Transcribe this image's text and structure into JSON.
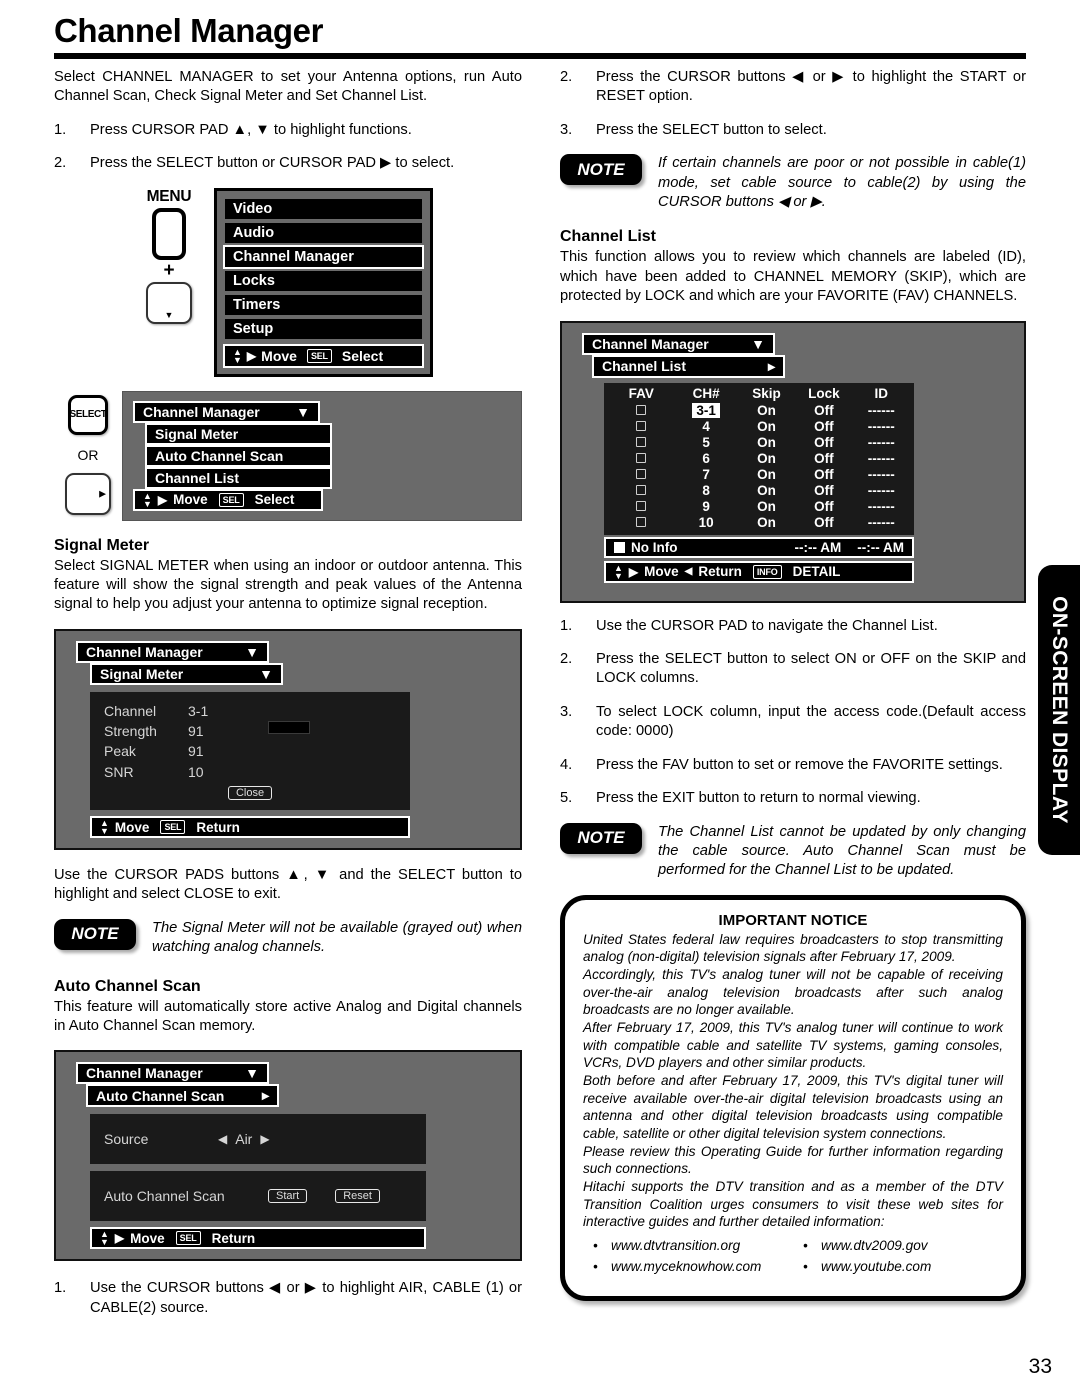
{
  "page": {
    "title": "Channel Manager",
    "number": "33",
    "side_tab": "ON-SCREEN DISPLAY"
  },
  "left": {
    "intro": "Select CHANNEL MANAGER to set your Antenna options, run Auto Channel Scan, Check Signal Meter and Set Channel List.",
    "steps": [
      {
        "num": "1.",
        "text": "Press CURSOR PAD ▲, ▼ to highlight functions."
      },
      {
        "num": "2.",
        "text": "Press the SELECT button or CURSOR PAD ▶ to select."
      }
    ],
    "menu_diagram": {
      "remote_label": "MENU",
      "plus": "+",
      "pad_glyph": "▼",
      "items": [
        "Video",
        "Audio",
        "Channel Manager",
        "Locks",
        "Timers",
        "Setup"
      ],
      "highlighted": "Channel Manager",
      "footer_move": "Move",
      "footer_sel": "SEL",
      "footer_select": "Select"
    },
    "submenu_diagram": {
      "key_select": "SELECT",
      "or": "OR",
      "pad_glyph": "▶",
      "header": "Channel Manager",
      "items": [
        "Signal Meter",
        "Auto Channel Scan",
        "Channel List"
      ],
      "footer_move": "Move",
      "footer_sel": "SEL",
      "footer_select": "Select"
    },
    "signal_meter": {
      "heading": "Signal Meter",
      "body": "Select SIGNAL METER when using an indoor or outdoor antenna. This feature will show the signal strength and peak values of the Antenna signal to help you adjust your antenna to optimize signal reception.",
      "osd": {
        "header": "Channel Manager",
        "subheader": "Signal Meter",
        "rows": [
          {
            "label": "Channel",
            "value": "3-1"
          },
          {
            "label": "Strength",
            "value": "91"
          },
          {
            "label": "Peak",
            "value": "91"
          },
          {
            "label": "SNR",
            "value": "10"
          }
        ],
        "close_button": "Close",
        "footer_move": "Move",
        "footer_sel": "SEL",
        "footer_return": "Return"
      },
      "after_text": "Use the CURSOR PADS buttons ▲, ▼ and the SELECT button to highlight and select CLOSE to exit.",
      "note_badge": "NOTE",
      "note_text": "The Signal Meter will not be available (grayed out) when watching analog channels."
    },
    "auto_channel_scan": {
      "heading": "Auto Channel Scan",
      "body": "This feature will automatically store active Analog and Digital channels in Auto Channel Scan memory.",
      "osd": {
        "header": "Channel Manager",
        "subheader": "Auto Channel Scan",
        "source_label": "Source",
        "source_value": "Air",
        "scan_label": "Auto Channel Scan",
        "start_button": "Start",
        "reset_button": "Reset",
        "footer_move": "Move",
        "footer_sel": "SEL",
        "footer_return": "Return"
      },
      "step": {
        "num": "1.",
        "text": "Use the CURSOR buttons ◀ or ▶ to highlight AIR, CABLE (1) or CABLE(2) source."
      }
    }
  },
  "right": {
    "steps_top": [
      {
        "num": "2.",
        "text": "Press the CURSOR buttons ◀ or ▶ to highlight the START or RESET option."
      },
      {
        "num": "3.",
        "text": "Press the SELECT button to select."
      }
    ],
    "note_top": {
      "badge": "NOTE",
      "text": "If certain channels are poor or not possible in cable(1) mode, set cable source to cable(2) by using the CURSOR buttons ◀ or ▶."
    },
    "channel_list": {
      "heading": "Channel List",
      "body": "This function allows you to review which channels are labeled (ID), which have been added to CHANNEL MEMORY (SKIP), which are protected by LOCK and which are your FAVORITE (FAV) CHANNELS.",
      "osd": {
        "header": "Channel Manager",
        "subheader": "Channel List",
        "columns": [
          "FAV",
          "CH#",
          "Skip",
          "Lock",
          "ID"
        ],
        "rows": [
          {
            "fav": "",
            "ch": "3-1",
            "skip": "On",
            "lock": "Off",
            "id": "------",
            "highlighted": true
          },
          {
            "fav": "",
            "ch": "4",
            "skip": "On",
            "lock": "Off",
            "id": "------",
            "highlighted": false
          },
          {
            "fav": "",
            "ch": "5",
            "skip": "On",
            "lock": "Off",
            "id": "------",
            "highlighted": false
          },
          {
            "fav": "",
            "ch": "6",
            "skip": "On",
            "lock": "Off",
            "id": "------",
            "highlighted": false
          },
          {
            "fav": "",
            "ch": "7",
            "skip": "On",
            "lock": "Off",
            "id": "------",
            "highlighted": false
          },
          {
            "fav": "",
            "ch": "8",
            "skip": "On",
            "lock": "Off",
            "id": "------",
            "highlighted": false
          },
          {
            "fav": "",
            "ch": "9",
            "skip": "On",
            "lock": "Off",
            "id": "------",
            "highlighted": false
          },
          {
            "fav": "",
            "ch": "10",
            "skip": "On",
            "lock": "Off",
            "id": "------",
            "highlighted": false
          }
        ],
        "info_label": "No Info",
        "info_time_start": "--:-- AM",
        "info_time_end": "--:-- AM",
        "footer_move": "Move",
        "footer_return": "Return",
        "footer_info_key": "INFO",
        "footer_detail": "DETAIL"
      },
      "steps": [
        {
          "num": "1.",
          "text": "Use the CURSOR PAD to navigate the Channel List."
        },
        {
          "num": "2.",
          "text": "Press the SELECT button to select ON or OFF on the SKIP and LOCK columns."
        },
        {
          "num": "3.",
          "text": "To select LOCK column, input the access code.(Default access code: 0000)"
        },
        {
          "num": "4.",
          "text": "Press the FAV button to set or remove the FAVORITE settings."
        },
        {
          "num": "5.",
          "text": "Press the EXIT button to return to normal viewing."
        }
      ],
      "note": {
        "badge": "NOTE",
        "text": "The Channel List cannot be updated by only changing the cable source. Auto Channel Scan must be performed for the Channel List to be updated."
      }
    },
    "notice": {
      "title": "IMPORTANT NOTICE",
      "paragraphs": [
        "United States federal law requires broadcasters to stop transmitting analog (non-digital) television signals after February 17, 2009.",
        "Accordingly, this TV's analog tuner will not be capable of receiving over-the-air analog television broadcasts after such analog broadcasts are no longer available.",
        "After February 17, 2009, this TV's analog tuner will continue to work with compatible cable and satellite TV systems, gaming consoles, VCRs, DVD players and other similar products.",
        "Both before and after February 17, 2009, this TV's digital tuner will receive available over-the-air digital television broadcasts using an antenna and other digital television broadcasts using compatible cable, satellite or other digital television system connections.",
        "Please review this Operating Guide for further information regarding such connections.",
        "Hitachi supports the DTV transition and as a member of the DTV Transition Coalition urges consumers to visit these web sites for interactive guides and further detailed information:"
      ],
      "links_left": [
        "www.dtvtransition.org",
        "www.myceknowhow.com"
      ],
      "links_right": [
        "www.dtv2009.gov",
        "www.youtube.com"
      ]
    }
  }
}
